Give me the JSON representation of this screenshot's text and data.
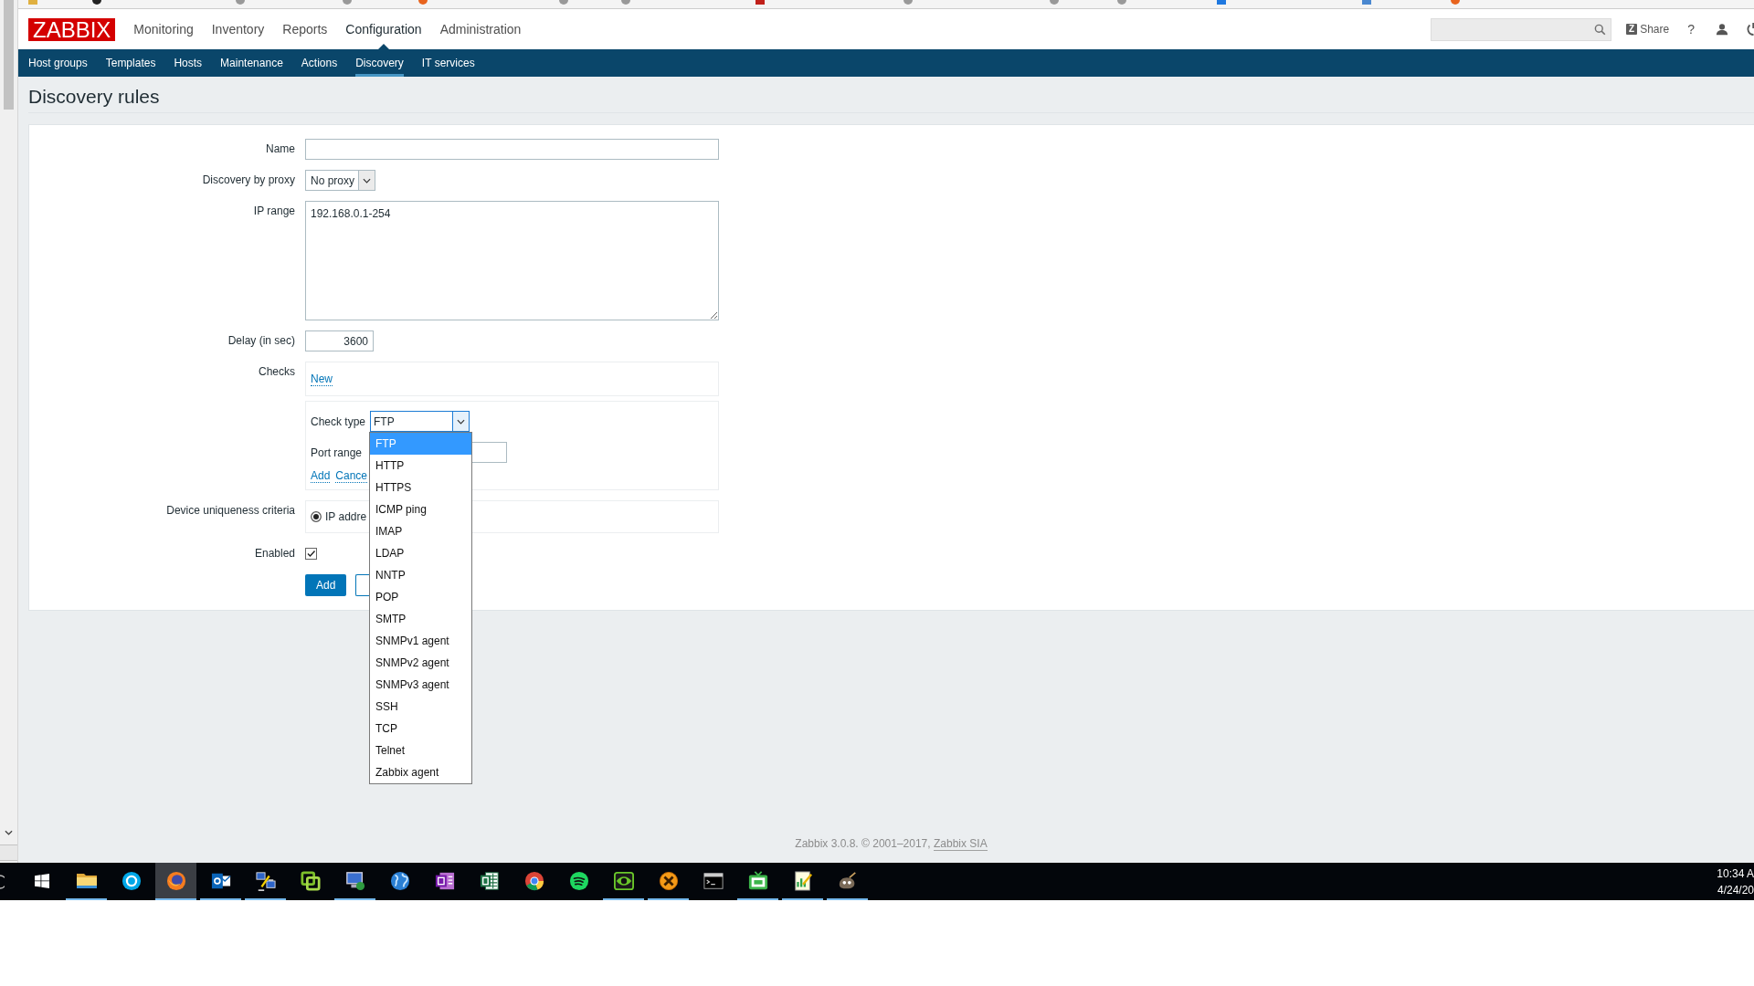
{
  "header": {
    "logo": "ZABBIX",
    "menu": [
      {
        "label": "Monitoring",
        "selected": false
      },
      {
        "label": "Inventory",
        "selected": false
      },
      {
        "label": "Reports",
        "selected": false
      },
      {
        "label": "Configuration",
        "selected": true
      },
      {
        "label": "Administration",
        "selected": false
      }
    ],
    "share_logo": "Z",
    "share": "Share",
    "help": "?"
  },
  "subnav": [
    {
      "label": "Host groups",
      "selected": false
    },
    {
      "label": "Templates",
      "selected": false
    },
    {
      "label": "Hosts",
      "selected": false
    },
    {
      "label": "Maintenance",
      "selected": false
    },
    {
      "label": "Actions",
      "selected": false
    },
    {
      "label": "Discovery",
      "selected": true
    },
    {
      "label": "IT services",
      "selected": false
    }
  ],
  "page_title": "Discovery rules",
  "form": {
    "fields": [
      {
        "kind": "text",
        "label": "Name"
      },
      {
        "kind": "select",
        "label": "Discovery by proxy",
        "value": "No proxy"
      },
      {
        "kind": "textarea",
        "label": "IP range",
        "value": "192.168.0.1-254"
      },
      {
        "kind": "number",
        "label": "Delay (in sec)",
        "value": "3600"
      },
      {
        "kind": "checks",
        "label": "Checks",
        "link": "New",
        "editor": {
          "check_type": {
            "label": "Check type",
            "value": "FTP",
            "expanded": true,
            "options": [
              {
                "label": "FTP",
                "selected": true
              },
              {
                "label": "HTTP",
                "selected": false
              },
              {
                "label": "HTTPS",
                "selected": false
              },
              {
                "label": "ICMP ping",
                "selected": false
              },
              {
                "label": "IMAP",
                "selected": false
              },
              {
                "label": "LDAP",
                "selected": false
              },
              {
                "label": "NNTP",
                "selected": false
              },
              {
                "label": "POP",
                "selected": false
              },
              {
                "label": "SMTP",
                "selected": false
              },
              {
                "label": "SNMPv1 agent",
                "selected": false
              },
              {
                "label": "SNMPv2 agent",
                "selected": false
              },
              {
                "label": "SNMPv3 agent",
                "selected": false
              },
              {
                "label": "SSH",
                "selected": false
              },
              {
                "label": "TCP",
                "selected": false
              },
              {
                "label": "Telnet",
                "selected": false
              },
              {
                "label": "Zabbix agent",
                "selected": false
              }
            ]
          },
          "port_range": {
            "label": "Port range"
          },
          "links": [
            "Add",
            "Cance"
          ]
        }
      },
      {
        "kind": "radio",
        "label": "Device uniqueness criteria",
        "options": [
          {
            "label": "IP addre",
            "selected": true
          }
        ]
      },
      {
        "kind": "checkbox",
        "label": "Enabled",
        "checked": true
      }
    ],
    "buttons": [
      {
        "kind": "primary",
        "label": "Add"
      },
      {
        "kind": "secondary"
      }
    ]
  },
  "footer": {
    "text": "Zabbix 3.0.8. © 2001–2017,",
    "link": "Zabbix SIA"
  },
  "taskbar": {
    "apps": [
      {
        "kind": "windows",
        "running": false,
        "selected": false
      },
      {
        "kind": "folder",
        "running": true,
        "selected": false
      },
      {
        "kind": "ring",
        "running": false,
        "selected": false
      },
      {
        "kind": "orb",
        "running": true,
        "selected": true
      },
      {
        "kind": "mail",
        "running": true,
        "selected": false
      },
      {
        "kind": "computers",
        "running": true,
        "selected": false
      },
      {
        "kind": "squares",
        "running": false,
        "selected": false
      },
      {
        "kind": "monitor",
        "running": true,
        "selected": false
      },
      {
        "kind": "globe",
        "running": false,
        "selected": false
      },
      {
        "kind": "notebook",
        "running": false,
        "selected": false
      },
      {
        "kind": "spreadsheet",
        "running": false,
        "selected": false
      },
      {
        "kind": "wheel",
        "running": false,
        "selected": false
      },
      {
        "kind": "waves",
        "running": false,
        "selected": false
      },
      {
        "kind": "eye",
        "running": true,
        "selected": false
      },
      {
        "kind": "xcircle",
        "running": true,
        "selected": false
      },
      {
        "kind": "terminal",
        "running": false,
        "selected": false
      },
      {
        "kind": "tv",
        "running": true,
        "selected": false
      },
      {
        "kind": "chartdoc",
        "running": true,
        "selected": false
      },
      {
        "kind": "mascot",
        "running": true,
        "selected": false
      }
    ],
    "clock": {
      "time": "10:34 A",
      "date": "4/24/20"
    }
  }
}
